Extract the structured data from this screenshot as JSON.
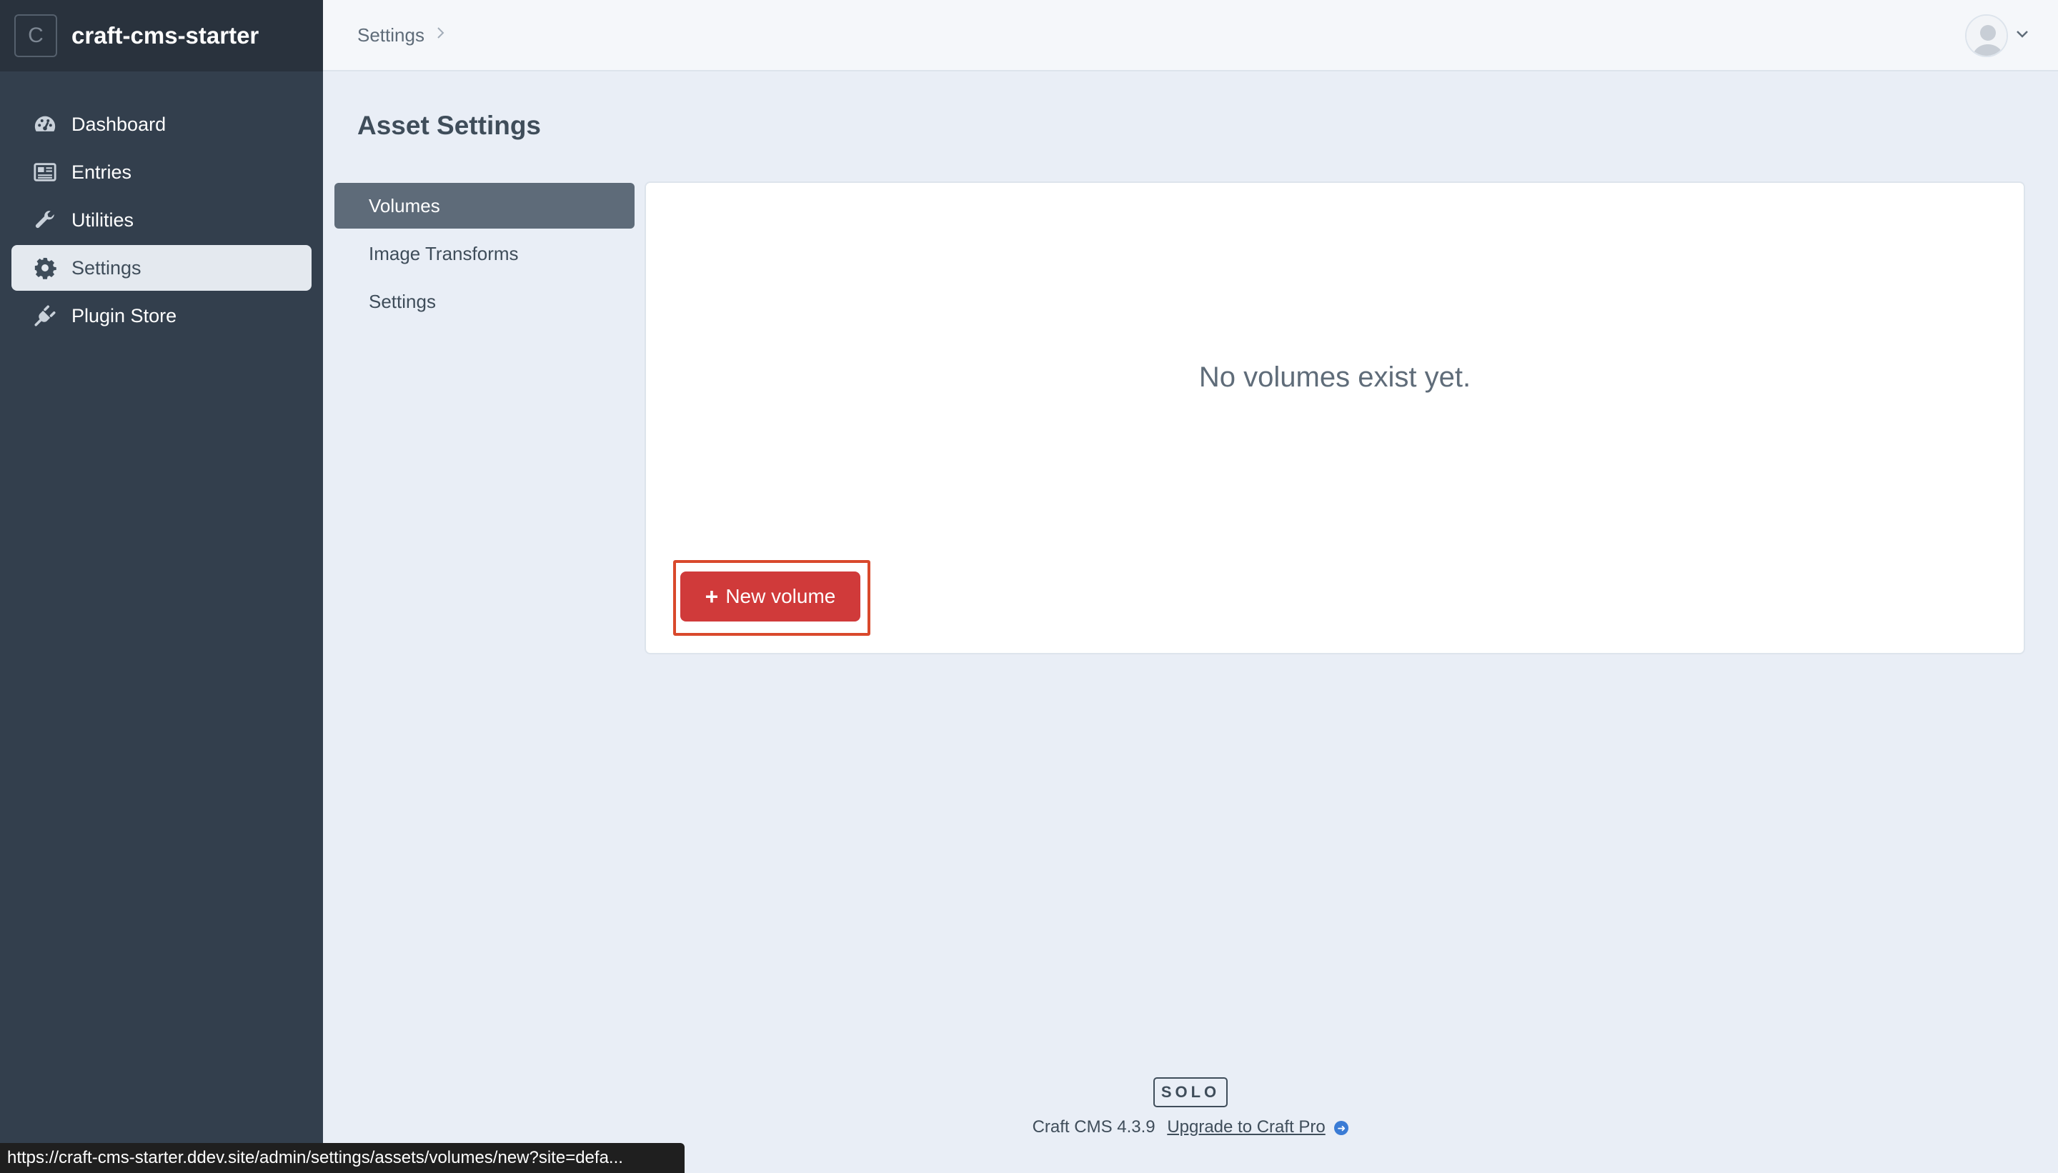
{
  "sidebar": {
    "site_initial": "C",
    "site_name": "craft-cms-starter",
    "items": [
      {
        "label": "Dashboard",
        "icon": "gauge-icon"
      },
      {
        "label": "Entries",
        "icon": "newspaper-icon"
      },
      {
        "label": "Utilities",
        "icon": "wrench-icon"
      },
      {
        "label": "Settings",
        "icon": "gear-icon",
        "active": true
      },
      {
        "label": "Plugin Store",
        "icon": "plug-icon"
      }
    ]
  },
  "topbar": {
    "breadcrumb": "Settings"
  },
  "main": {
    "title": "Asset Settings",
    "subnav": [
      {
        "label": "Volumes",
        "active": true
      },
      {
        "label": "Image Transforms"
      },
      {
        "label": "Settings"
      }
    ],
    "empty_message": "No volumes exist yet.",
    "new_button_label": "New volume"
  },
  "footer": {
    "edition": "SOLO",
    "version": "Craft CMS 4.3.9",
    "upgrade_link": "Upgrade to Craft Pro"
  },
  "statusbar": {
    "url": "https://craft-cms-starter.ddev.site/admin/settings/assets/volumes/new?site=defa..."
  },
  "colors": {
    "sidebar_bg": "#333f4d",
    "accent_red": "#d03a3a",
    "highlight_border": "#d9492c",
    "page_bg": "#e9eef6"
  }
}
